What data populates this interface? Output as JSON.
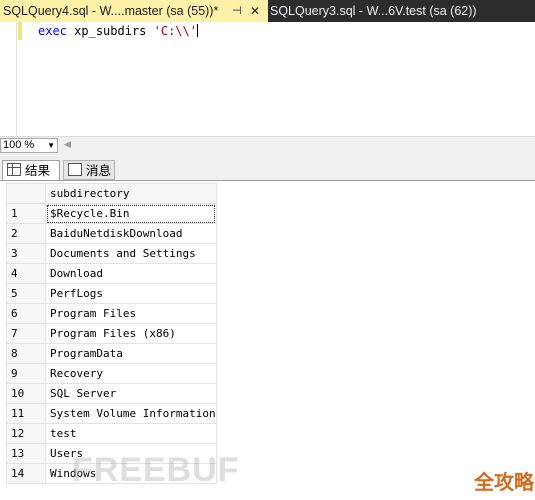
{
  "tabs": {
    "active_title": "SQLQuery4.sql - W....master (sa (55))*",
    "pin_glyph": "⊣",
    "close_glyph": "✕",
    "inactive_title": "SQLQuery3.sql - W...6V.test (sa (62))"
  },
  "editor": {
    "keyword": "exec",
    "proc": "xp_subdirs",
    "string": "'C:\\\\'"
  },
  "status": {
    "zoom": "100 %"
  },
  "results_tabs": {
    "results": "结果",
    "messages": "消息"
  },
  "grid": {
    "column": "subdirectory",
    "rows": [
      {
        "n": "1",
        "v": "$Recycle.Bin"
      },
      {
        "n": "2",
        "v": "BaiduNetdiskDownload"
      },
      {
        "n": "3",
        "v": "Documents and Settings"
      },
      {
        "n": "4",
        "v": "Download"
      },
      {
        "n": "5",
        "v": "PerfLogs"
      },
      {
        "n": "6",
        "v": "Program Files"
      },
      {
        "n": "7",
        "v": "Program Files (x86)"
      },
      {
        "n": "8",
        "v": "ProgramData"
      },
      {
        "n": "9",
        "v": "Recovery"
      },
      {
        "n": "10",
        "v": "SQL Server"
      },
      {
        "n": "11",
        "v": "System Volume Information"
      },
      {
        "n": "12",
        "v": "test"
      },
      {
        "n": "13",
        "v": "Users"
      },
      {
        "n": "14",
        "v": "Windows"
      }
    ]
  },
  "watermark": {
    "freebuf": "FREEBUF",
    "site": "全攻略"
  }
}
